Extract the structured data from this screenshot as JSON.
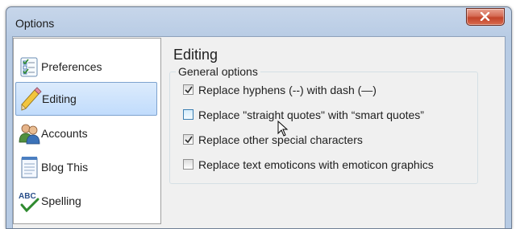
{
  "window": {
    "title": "Options"
  },
  "sidebar": {
    "items": [
      {
        "label": "Preferences",
        "icon": "preferences-checklist-icon",
        "selected": false
      },
      {
        "label": "Editing",
        "icon": "pencil-icon",
        "selected": true
      },
      {
        "label": "Accounts",
        "icon": "users-icon",
        "selected": false
      },
      {
        "label": "Blog This",
        "icon": "notepad-icon",
        "selected": false
      },
      {
        "label": "Spelling",
        "icon": "abc-spellcheck-icon",
        "selected": false
      }
    ]
  },
  "main": {
    "title": "Editing",
    "group_label": "General options",
    "options": [
      {
        "label": "Replace hyphens (--) with dash (—)",
        "checked": true
      },
      {
        "label": "Replace \"straight quotes\" with “smart quotes”",
        "checked": false
      },
      {
        "label": "Replace other special characters",
        "checked": true
      },
      {
        "label": "Replace text emoticons with emoticon graphics",
        "checked": false
      }
    ]
  },
  "colors": {
    "selection": "#c1dcfc",
    "close_button": "#c2432a",
    "window_frame": "#b7cbe4"
  }
}
